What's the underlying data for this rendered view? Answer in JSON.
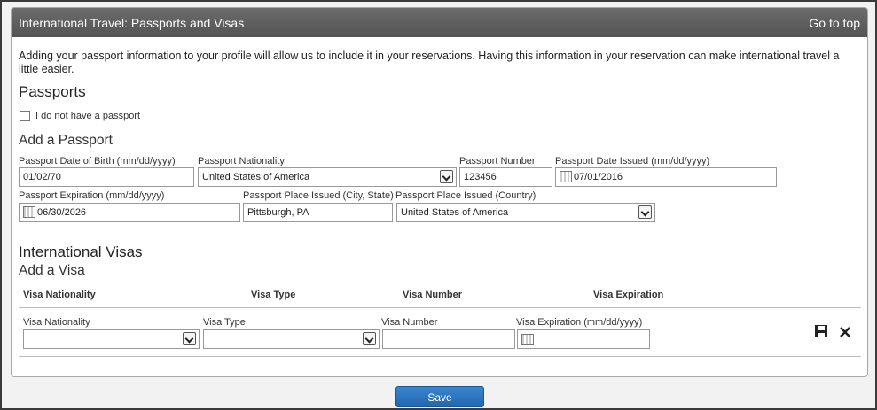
{
  "section": {
    "title": "International Travel: Passports and Visas",
    "go_to_top": "Go to top"
  },
  "intro_text": "Adding your passport information to your profile will allow us to include it in your reservations. Having this information in your reservation can make international travel a little easier.",
  "passports": {
    "heading": "Passports",
    "no_passport_label": "I do not have a passport",
    "add_heading": "Add a Passport",
    "fields": {
      "dob_label": "Passport Date of Birth (mm/dd/yyyy)",
      "dob_value": "01/02/70",
      "nationality_label": "Passport Nationality",
      "nationality_value": "United States of America",
      "number_label": "Passport Number",
      "number_value": "123456",
      "issued_label": "Passport Date Issued (mm/dd/yyyy)",
      "issued_value": "07/01/2016",
      "expiration_label": "Passport Expiration (mm/dd/yyyy)",
      "expiration_value": "06/30/2026",
      "place_city_label": "Passport Place Issued (City, State)",
      "place_city_value": "Pittsburgh, PA",
      "place_country_label": "Passport Place Issued (Country)",
      "place_country_value": "United States of America"
    }
  },
  "visas": {
    "heading": "International Visas",
    "add_heading": "Add a Visa",
    "columns": [
      "Visa Nationality",
      "Visa Type",
      "Visa Number",
      "Visa Expiration"
    ],
    "form": {
      "nationality_label": "Visa Nationality",
      "nationality_value": "",
      "type_label": "Visa Type",
      "type_value": "",
      "number_label": "Visa Number",
      "number_value": "",
      "expiration_label": "Visa Expiration (mm/dd/yyyy)",
      "expiration_value": ""
    },
    "icons": [
      "save-icon",
      "close-icon"
    ]
  },
  "save_button": "Save",
  "colors": {
    "header_bg": "#5e5e5e",
    "button_blue": "#2a6fba"
  }
}
